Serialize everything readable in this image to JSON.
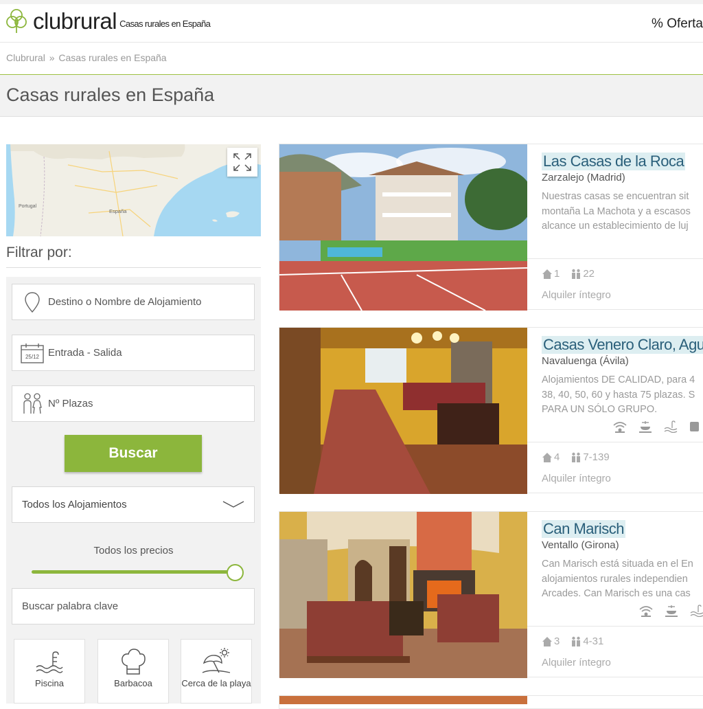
{
  "header": {
    "brand": "clubrural",
    "tagline": "Casas rurales en España",
    "ofertas_label": "% Oferta",
    "brand_color": "#8cb63c"
  },
  "breadcrumb": {
    "home": "Clubrural",
    "separator": "»",
    "current": "Casas rurales en España"
  },
  "page_title": "Casas rurales en España",
  "map": {
    "labels": [
      "Portugal",
      "España"
    ]
  },
  "filters": {
    "title": "Filtrar por:",
    "destination_placeholder": "Destino o Nombre de Alojamiento",
    "calendar_icon_text": "25/12",
    "dates_placeholder": "Entrada - Salida",
    "guests_placeholder": "Nº Plazas",
    "search_button": "Buscar",
    "type_select": "Todos los Alojamientos",
    "price_label": "Todos los precios",
    "price_level": 1.0,
    "keyword_placeholder": "Buscar palabra clave",
    "amenities": [
      {
        "label": "Piscina",
        "icon": "pool-icon"
      },
      {
        "label": "Barbacoa",
        "icon": "chef-hat-icon"
      },
      {
        "label": "Cerca de la playa",
        "icon": "beach-icon"
      }
    ]
  },
  "listings": [
    {
      "name": "Las Casas de la Roca",
      "location": "Zarzalejo (Madrid)",
      "description": [
        "Nuestras casas se encuentran sit",
        "montaña La Machota y a escasos",
        "alcance un establecimiento de luj"
      ],
      "houses": "1",
      "capacity": "22",
      "rental": "Alquiler íntegro",
      "feature_icons": []
    },
    {
      "name": "Casas Venero Claro, Agua",
      "location": "Navaluenga (Ávila)",
      "description": [
        "Alojamientos DE CALIDAD, para 4",
        "38, 40, 50, 60 y hasta 75 plazas. S",
        "PARA UN SÓLO GRUPO."
      ],
      "houses": "4",
      "capacity": "7-139",
      "rental": "Alquiler íntegro",
      "feature_icons": [
        "wifi-icon",
        "bbq-icon",
        "pool-icon",
        "tv-icon"
      ]
    },
    {
      "name": "Can Marisch",
      "location": "Ventallo (Girona)",
      "description": [
        "Can Marisch está situada en el En",
        "alojamientos rurales independien",
        "Arcades. Can Marisch es una cas"
      ],
      "houses": "3",
      "capacity": "4-31",
      "rental": "Alquiler íntegro",
      "feature_icons": [
        "wifi-icon",
        "bbq-icon",
        "pool-icon"
      ]
    }
  ]
}
